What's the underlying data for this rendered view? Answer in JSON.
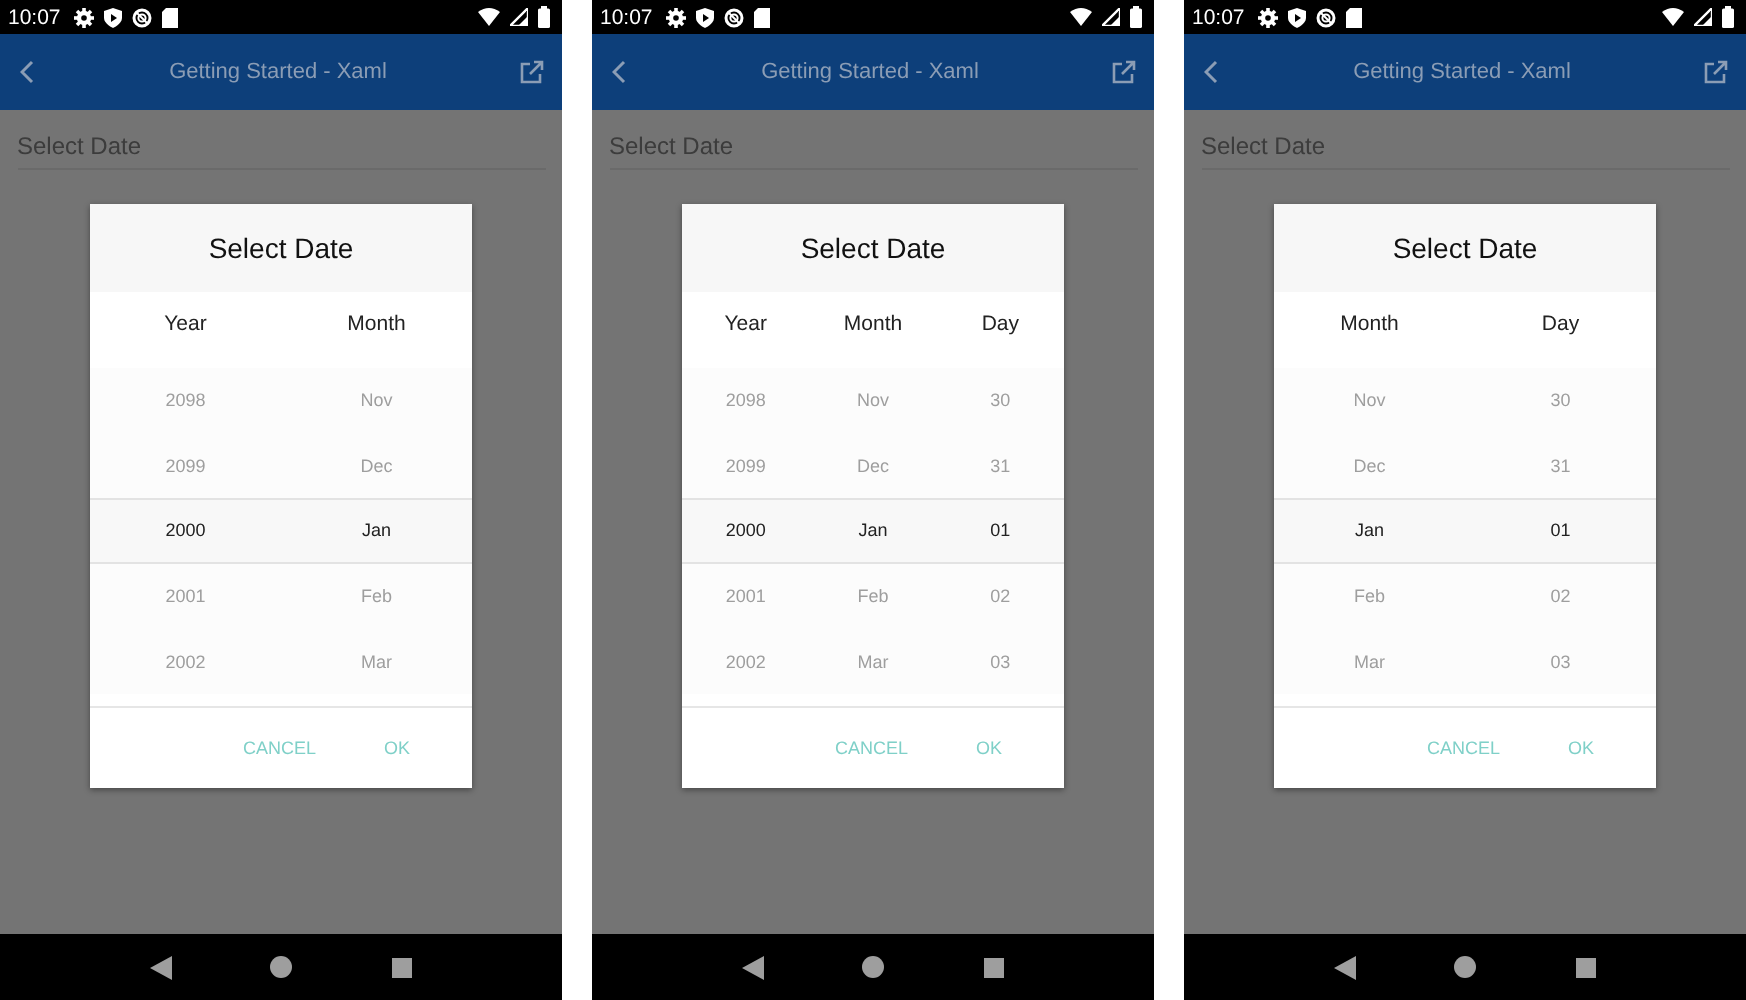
{
  "screens": [
    {
      "status_time": "10:07",
      "title": "Getting Started - Xaml",
      "field": {
        "placeholder": "Select Date"
      },
      "dialog": {
        "title": "Select Date",
        "columns": [
          {
            "header": "Year",
            "items": [
              {
                "text": "2098",
                "selected": false
              },
              {
                "text": "2099",
                "selected": false
              },
              {
                "text": "2000",
                "selected": true
              },
              {
                "text": "2001",
                "selected": false
              },
              {
                "text": "2002",
                "selected": false
              }
            ]
          },
          {
            "header": "Month",
            "items": [
              {
                "text": "Nov",
                "selected": false
              },
              {
                "text": "Dec",
                "selected": false
              },
              {
                "text": "Jan",
                "selected": true
              },
              {
                "text": "Feb",
                "selected": false
              },
              {
                "text": "Mar",
                "selected": false
              }
            ]
          }
        ],
        "buttons": [
          "CANCEL",
          "OK"
        ]
      }
    },
    {
      "status_time": "10:07",
      "title": "Getting Started - Xaml",
      "field": {
        "placeholder": "Select Date"
      },
      "dialog": {
        "title": "Select Date",
        "columns": [
          {
            "header": "Year",
            "items": [
              {
                "text": "2098",
                "selected": false
              },
              {
                "text": "2099",
                "selected": false
              },
              {
                "text": "2000",
                "selected": true
              },
              {
                "text": "2001",
                "selected": false
              },
              {
                "text": "2002",
                "selected": false
              }
            ]
          },
          {
            "header": "Month",
            "items": [
              {
                "text": "Nov",
                "selected": false
              },
              {
                "text": "Dec",
                "selected": false
              },
              {
                "text": "Jan",
                "selected": true
              },
              {
                "text": "Feb",
                "selected": false
              },
              {
                "text": "Mar",
                "selected": false
              }
            ]
          },
          {
            "header": "Day",
            "items": [
              {
                "text": "30",
                "selected": false
              },
              {
                "text": "31",
                "selected": false
              },
              {
                "text": "01",
                "selected": true
              },
              {
                "text": "02",
                "selected": false
              },
              {
                "text": "03",
                "selected": false
              }
            ]
          }
        ],
        "buttons": [
          "CANCEL",
          "OK"
        ]
      }
    },
    {
      "status_time": "10:07",
      "title": "Getting Started - Xaml",
      "field": {
        "placeholder": "Select Date"
      },
      "dialog": {
        "title": "Select Date",
        "columns": [
          {
            "header": "Month",
            "items": [
              {
                "text": "Nov",
                "selected": false
              },
              {
                "text": "Dec",
                "selected": false
              },
              {
                "text": "Jan",
                "selected": true
              },
              {
                "text": "Feb",
                "selected": false
              },
              {
                "text": "Mar",
                "selected": false
              }
            ]
          },
          {
            "header": "Day",
            "items": [
              {
                "text": "30",
                "selected": false
              },
              {
                "text": "31",
                "selected": false
              },
              {
                "text": "01",
                "selected": true
              },
              {
                "text": "02",
                "selected": false
              },
              {
                "text": "03",
                "selected": false
              }
            ]
          }
        ],
        "buttons": [
          "CANCEL",
          "OK"
        ]
      }
    }
  ]
}
